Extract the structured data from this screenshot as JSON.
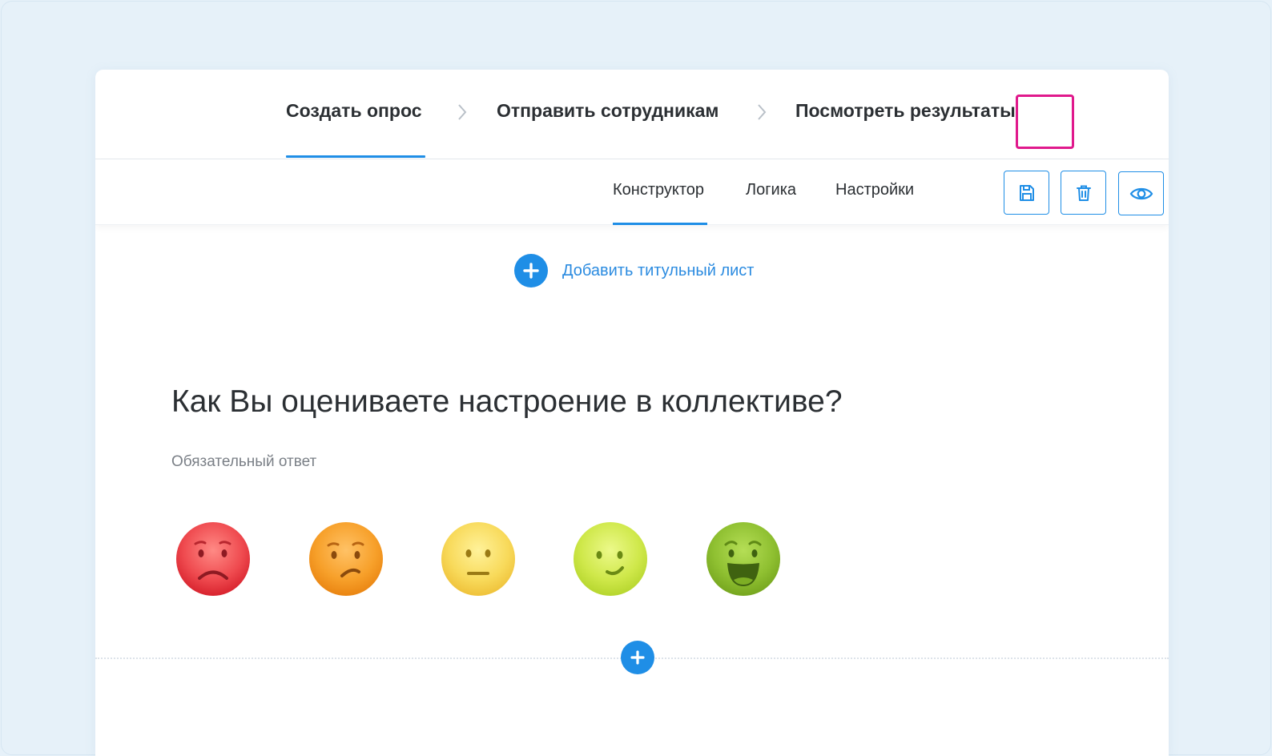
{
  "steps": [
    {
      "label": "Создать опрос",
      "active": true
    },
    {
      "label": "Отправить сотрудникам",
      "active": false
    },
    {
      "label": "Посмотреть результаты",
      "active": false
    }
  ],
  "tabs": [
    {
      "label": "Конструктор",
      "active": true
    },
    {
      "label": "Логика",
      "active": false
    },
    {
      "label": "Настройки",
      "active": false
    }
  ],
  "toolbar": {
    "buttons": [
      {
        "icon": "save-icon"
      },
      {
        "icon": "trash-icon"
      },
      {
        "icon": "eye-icon",
        "highlighted": true
      }
    ]
  },
  "add_title_page": {
    "label": "Добавить титульный лист",
    "icon": "plus-icon"
  },
  "question": {
    "title": "Как Вы оцениваете настроение в коллективе?",
    "required_label": "Обязательный ответ",
    "scale": [
      {
        "mood": "very-sad",
        "color": "#e8353d"
      },
      {
        "mood": "sad",
        "color": "#f49a1f"
      },
      {
        "mood": "neutral",
        "color": "#f5d147"
      },
      {
        "mood": "content",
        "color": "#c5e03a"
      },
      {
        "mood": "happy",
        "color": "#86b828"
      }
    ]
  },
  "colors": {
    "accent": "#1f8ee6",
    "highlight": "#e0198c",
    "background": "#e6f1f9"
  }
}
